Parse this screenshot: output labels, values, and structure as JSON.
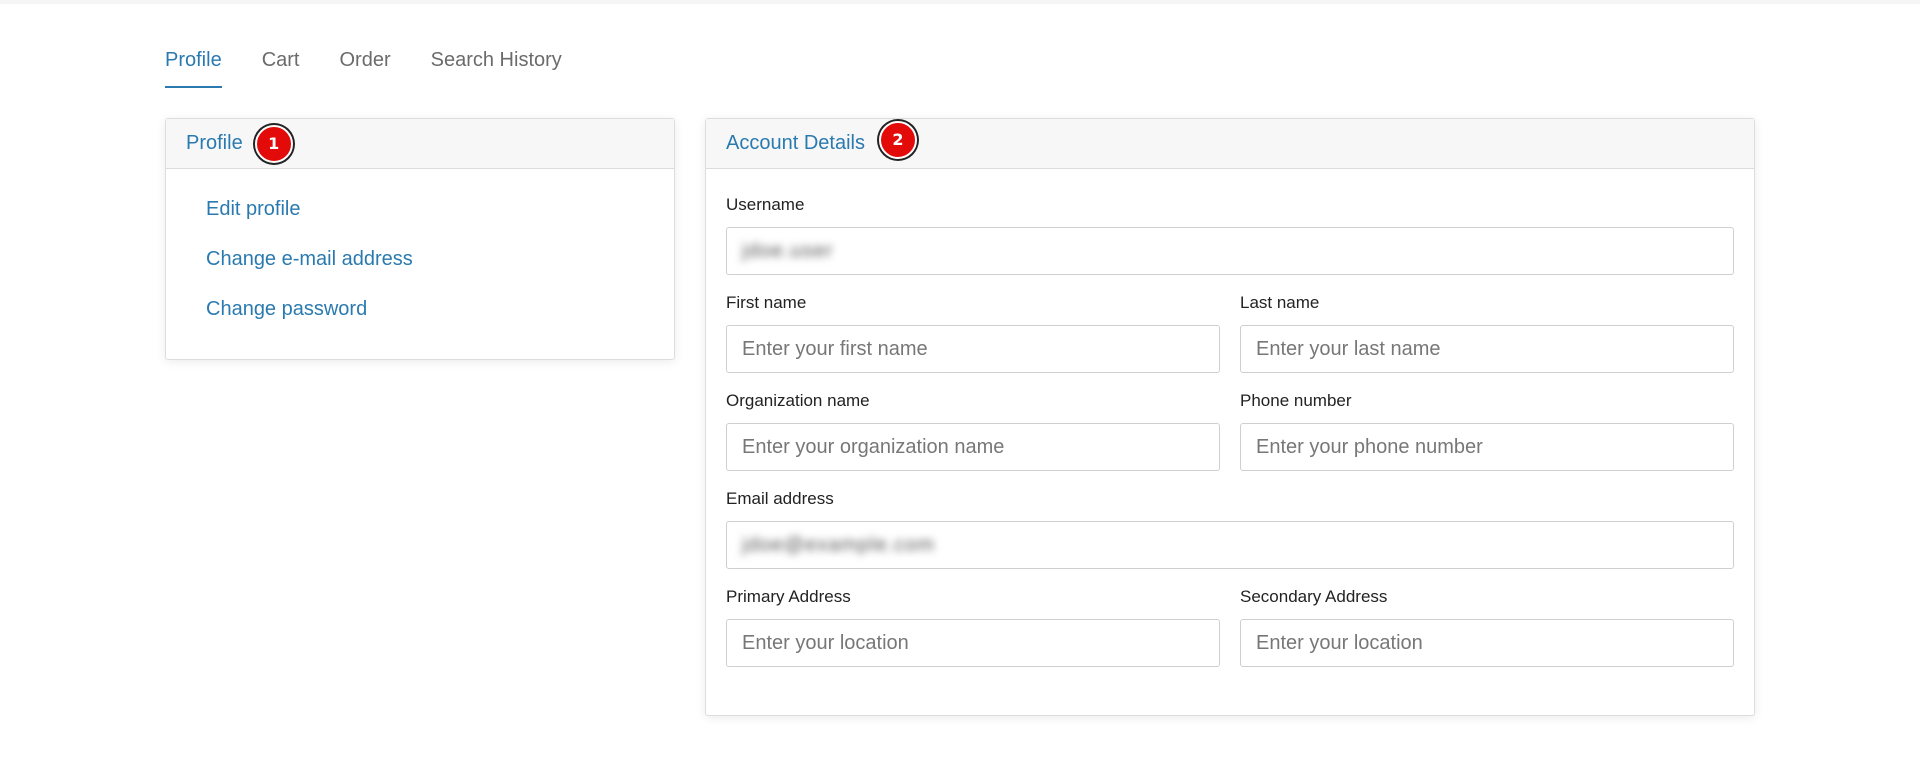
{
  "tabs": [
    {
      "label": "Profile",
      "active": true
    },
    {
      "label": "Cart",
      "active": false
    },
    {
      "label": "Order",
      "active": false
    },
    {
      "label": "Search History",
      "active": false
    }
  ],
  "profile_panel": {
    "title": "Profile",
    "badge": "1",
    "menu": [
      {
        "label": "Edit profile"
      },
      {
        "label": "Change e-mail address"
      },
      {
        "label": "Change password"
      }
    ]
  },
  "account_panel": {
    "title": "Account Details",
    "badge": "2",
    "fields": {
      "username": {
        "label": "Username",
        "value": "jdoe.user"
      },
      "first_name": {
        "label": "First name",
        "placeholder": "Enter your first name",
        "value": ""
      },
      "last_name": {
        "label": "Last name",
        "placeholder": "Enter your last name",
        "value": ""
      },
      "organization": {
        "label": "Organization name",
        "placeholder": "Enter your organization name",
        "value": ""
      },
      "phone": {
        "label": "Phone number",
        "placeholder": "Enter your phone number",
        "value": ""
      },
      "email": {
        "label": "Email address",
        "value": "jdoe@example.com"
      },
      "primary_address": {
        "label": "Primary Address",
        "placeholder": "Enter your location",
        "value": ""
      },
      "secondary_address": {
        "label": "Secondary Address",
        "placeholder": "Enter your location",
        "value": ""
      }
    }
  },
  "colors": {
    "accent": "#2a7ab0",
    "badge": "#e30a0a",
    "panel_header_bg": "#f7f7f7"
  }
}
